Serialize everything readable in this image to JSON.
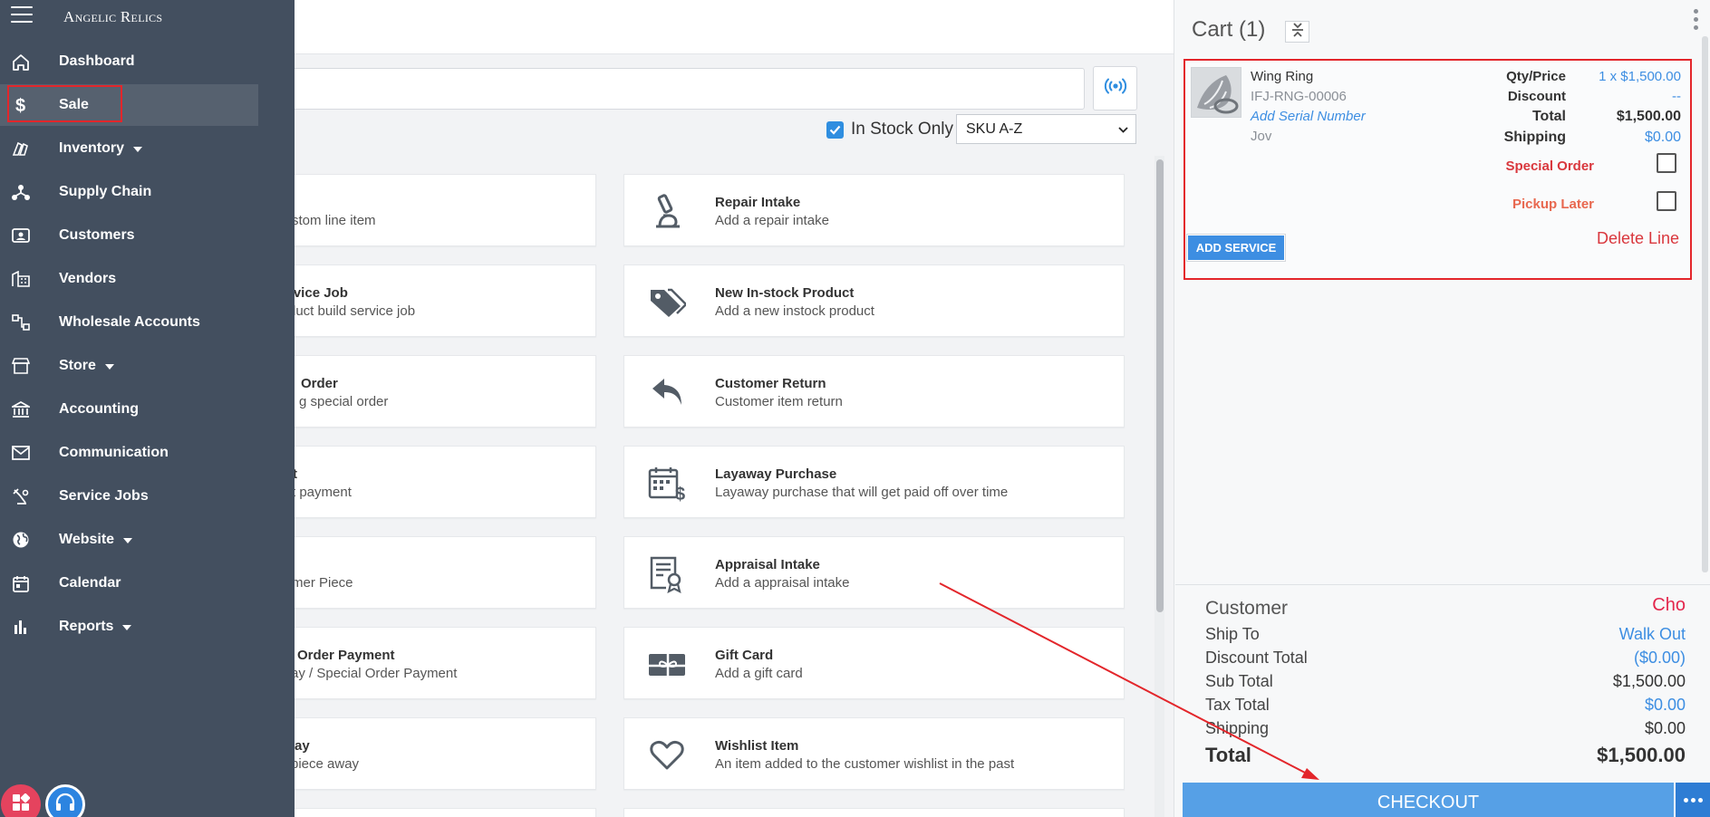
{
  "brand": "Angelic Relics",
  "sidebar": {
    "items": [
      {
        "label": "Dashboard",
        "icon": "home-icon"
      },
      {
        "label": "Sale",
        "icon": "dollar-icon"
      },
      {
        "label": "Inventory",
        "icon": "inventory-icon"
      },
      {
        "label": "Supply Chain",
        "icon": "supply-chain-icon"
      },
      {
        "label": "Customers",
        "icon": "customers-icon"
      },
      {
        "label": "Vendors",
        "icon": "vendors-icon"
      },
      {
        "label": "Wholesale Accounts",
        "icon": "wholesale-icon"
      },
      {
        "label": "Store",
        "icon": "store-icon"
      },
      {
        "label": "Accounting",
        "icon": "bank-icon"
      },
      {
        "label": "Communication",
        "icon": "mail-icon"
      },
      {
        "label": "Service Jobs",
        "icon": "service-jobs-icon"
      },
      {
        "label": "Website",
        "icon": "globe-icon"
      },
      {
        "label": "Calendar",
        "icon": "calendar-icon"
      },
      {
        "label": "Reports",
        "icon": "bar-chart-icon"
      }
    ]
  },
  "toolbar": {
    "in_stock_only_label": "In Stock Only",
    "in_stock_only_checked": true,
    "sort_value": "SKU A-Z"
  },
  "tiles_left": [
    {
      "title": "",
      "subtitle": "stom line item"
    },
    {
      "title": "rvice Job",
      "subtitle": "duct build service job"
    },
    {
      "title": "Order",
      "subtitle": "g special order"
    },
    {
      "title": "t",
      "subtitle": "t payment"
    },
    {
      "title": "",
      "subtitle": "mer Piece"
    },
    {
      "title": "Order Payment",
      "subtitle": "ay / Special Order Payment"
    },
    {
      "title": "ay",
      "subtitle": "piece away"
    }
  ],
  "tiles_right": [
    {
      "title": "Repair Intake",
      "subtitle": "Add a repair intake",
      "icon": "microscope-icon"
    },
    {
      "title": "New In-stock Product",
      "subtitle": "Add a new instock product",
      "icon": "price-tags-icon"
    },
    {
      "title": "Customer Return",
      "subtitle": "Customer item return",
      "icon": "return-arrow-icon"
    },
    {
      "title": "Layaway Purchase",
      "subtitle": "Layaway purchase that will get paid off over time",
      "icon": "calendar-dollar-icon"
    },
    {
      "title": "Appraisal Intake",
      "subtitle": "Add a appraisal intake",
      "icon": "certificate-icon"
    },
    {
      "title": "Gift Card",
      "subtitle": "Add a gift card",
      "icon": "gift-card-icon"
    },
    {
      "title": "Wishlist Item",
      "subtitle": "An item added to the customer wishlist in the past",
      "icon": "heart-icon"
    }
  ],
  "cart": {
    "title": "Cart (1)",
    "line": {
      "name": "Wing Ring",
      "sku": "IFJ-RNG-00006",
      "add_serial": "Add Serial Number",
      "salesperson": "Jov",
      "qty_price_label": "Qty/Price",
      "qty_price_prefix": "1 x ",
      "qty_price_value": "$1,500.00",
      "discount_label": "Discount",
      "discount_value": "--",
      "total_label": "Total",
      "total_value": "$1,500.00",
      "shipping_label": "Shipping",
      "shipping_value": "$0.00",
      "special_order_label": "Special Order",
      "pickup_later_label": "Pickup Later",
      "delete_label": "Delete Line",
      "add_service_label": "ADD SERVICE"
    },
    "summary": {
      "customer_label": "Customer",
      "customer_value": "Cho",
      "ship_to_label": "Ship To",
      "ship_to_value": "Walk Out",
      "discount_total_label": "Discount Total",
      "discount_total_value": "($0.00)",
      "sub_total_label": "Sub Total",
      "sub_total_value": "$1,500.00",
      "tax_total_label": "Tax Total",
      "tax_total_value": "$0.00",
      "shipping_label": "Shipping",
      "shipping_value": "$0.00",
      "total_label": "Total",
      "total_value": "$1,500.00"
    },
    "checkout_label": "CHECKOUT"
  },
  "colors": {
    "sidebar_bg": "#434f5f",
    "accent_blue": "#3d8ee2",
    "annotation_red": "#e3262b",
    "warning_red": "#d9373d"
  }
}
